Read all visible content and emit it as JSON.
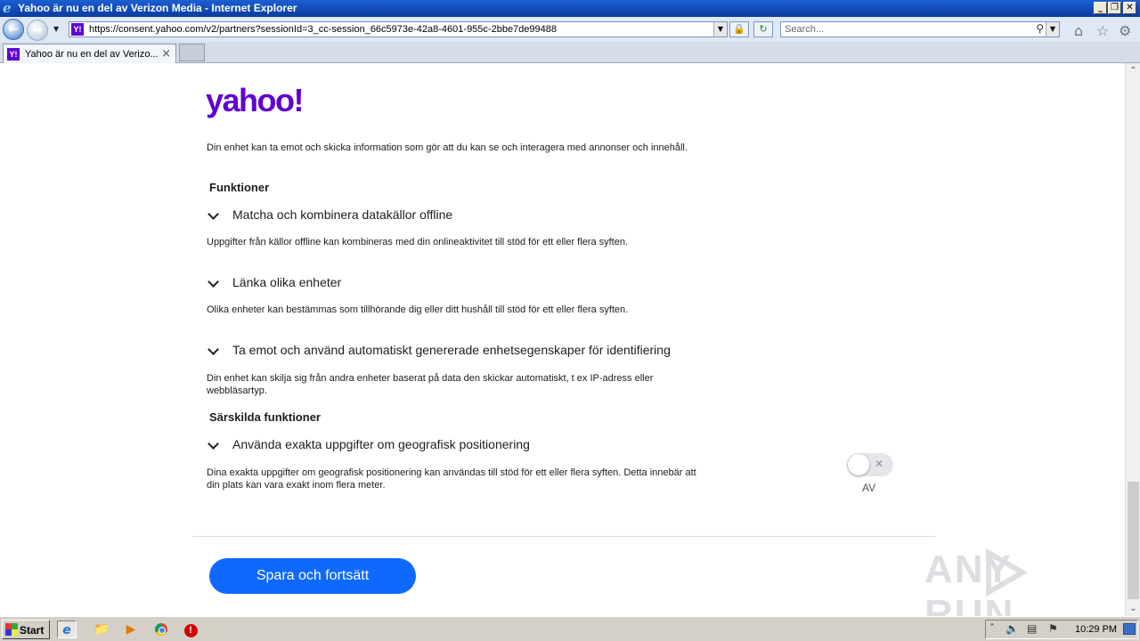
{
  "window": {
    "title": "Yahoo är nu en del av Verizon Media - Internet Explorer",
    "controls": [
      "_",
      "❐",
      "✕"
    ]
  },
  "address_bar": {
    "url": "https://consent.yahoo.com/v2/partners?sessionId=3_cc-session_66c5973e-42a8-4601-955c-2bbe7de99488",
    "favicon_text": "Y!"
  },
  "search": {
    "placeholder": "Search..."
  },
  "tabs": [
    {
      "label": "Yahoo är nu en del av Verizo...",
      "active": true
    }
  ],
  "page": {
    "logo": "yahoo!",
    "intro": "Din enhet kan ta emot och skicka information som gör att du kan se och interagera med annonser och innehåll.",
    "sections": [
      {
        "heading": "Funktioner",
        "items": [
          {
            "title": "Matcha och kombinera datakällor offline",
            "description": "Uppgifter från källor offline kan kombineras med din onlineaktivitet till stöd för ett eller flera syften."
          },
          {
            "title": "Länka olika enheter",
            "description": "Olika enheter kan bestämmas som tillhörande dig eller ditt hushåll till stöd för ett eller flera syften."
          },
          {
            "title": "Ta emot och använd automatiskt genererade enhetsegenskaper för identifiering",
            "description": "Din enhet kan skilja sig från andra enheter baserat på data den skickar automatiskt, t ex IP-adress eller webbläsartyp."
          }
        ]
      },
      {
        "heading": "Särskilda funktioner",
        "items": [
          {
            "title": "Använda exakta uppgifter om geografisk positionering",
            "description": "Dina exakta uppgifter om geografisk positionering kan användas till stöd för ett eller flera syften. Detta innebär att din plats kan vara exakt inom flera meter.",
            "toggle_state": "off",
            "toggle_label": "AV"
          }
        ]
      }
    ],
    "save_button": "Spara och fortsätt",
    "watermark": "ANY RUN"
  },
  "taskbar": {
    "start_label": "Start",
    "clock": "10:29 PM"
  },
  "colors": {
    "yahoo_purple": "#6001d2",
    "button_blue": "#0f69ff",
    "titlebar_blue": "#0a3c9e"
  }
}
